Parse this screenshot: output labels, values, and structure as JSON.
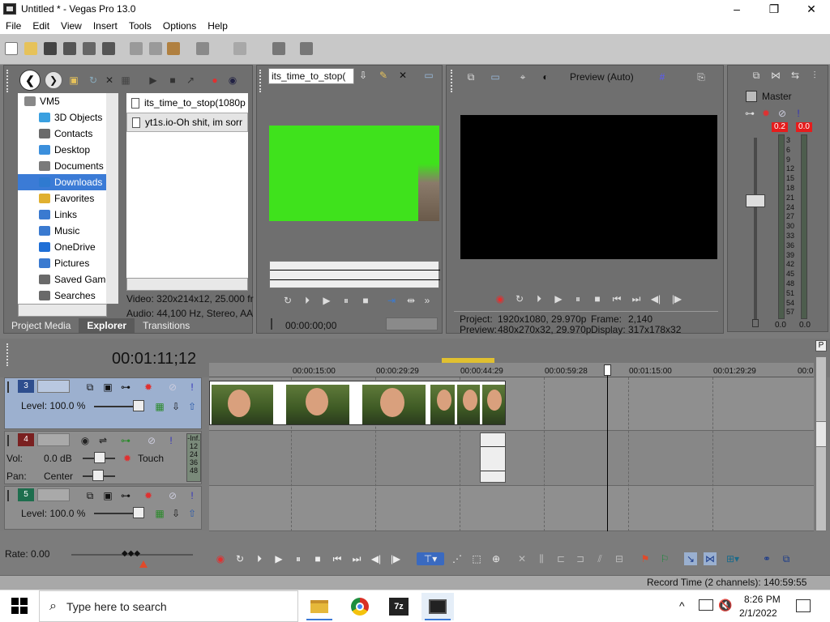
{
  "window": {
    "title": "Untitled * - Vegas Pro 13.0",
    "minimize": "–",
    "maximize": "❐",
    "close": "✕"
  },
  "menu": [
    "File",
    "Edit",
    "View",
    "Insert",
    "Tools",
    "Options",
    "Help"
  ],
  "explorer": {
    "tree": [
      {
        "label": "VM5",
        "icon": "computer-icon",
        "color": "#888888"
      },
      {
        "label": "3D Objects",
        "icon": "3d-objects-icon",
        "color": "#3aa0e0"
      },
      {
        "label": "Contacts",
        "icon": "contacts-icon",
        "color": "#6a6a6a"
      },
      {
        "label": "Desktop",
        "icon": "desktop-icon",
        "color": "#3b8fdc"
      },
      {
        "label": "Documents",
        "icon": "documents-icon",
        "color": "#7a7a7a"
      },
      {
        "label": "Downloads",
        "icon": "downloads-icon",
        "color": "#2f7ad0",
        "selected": true
      },
      {
        "label": "Favorites",
        "icon": "star-icon",
        "color": "#e0b030"
      },
      {
        "label": "Links",
        "icon": "links-icon",
        "color": "#3a7ad0"
      },
      {
        "label": "Music",
        "icon": "music-icon",
        "color": "#3a7ad0"
      },
      {
        "label": "OneDrive",
        "icon": "onedrive-icon",
        "color": "#1f6fd6"
      },
      {
        "label": "Pictures",
        "icon": "pictures-icon",
        "color": "#3a7ad0"
      },
      {
        "label": "Saved Game",
        "icon": "saved-games-icon",
        "color": "#6a6a6a"
      },
      {
        "label": "Searches",
        "icon": "search-icon",
        "color": "#6a6a6a"
      }
    ],
    "files": [
      {
        "label": "its_time_to_stop(1080p"
      },
      {
        "label": "yt1s.io-Oh shit, im sorr",
        "selected": true
      }
    ],
    "info_video": "Video: 320x214x12, 25.000 fr",
    "info_audio": "Audio: 44,100 Hz, Stereo, AA",
    "tabs": [
      "Project Media",
      "Explorer",
      "Transitions"
    ],
    "active_tab": "Explorer"
  },
  "trimmer": {
    "source": "its_time_to_stop(",
    "timecode": "00:00:00;00"
  },
  "preview": {
    "mode": "Preview (Auto)",
    "project_label": "Project:",
    "project_value": "1920x1080, 29.970p",
    "preview_label": "Preview:",
    "preview_value": "480x270x32, 29.970p",
    "frame_label": "Frame:",
    "frame_value": "2,140",
    "display_label": "Display:",
    "display_value": "317x178x32"
  },
  "mixer": {
    "title": "Master",
    "peak_left": "0.2",
    "peak_right": "0.0",
    "scale": [
      "3",
      "6",
      "9",
      "12",
      "15",
      "18",
      "21",
      "24",
      "27",
      "30",
      "33",
      "36",
      "39",
      "42",
      "45",
      "48",
      "51",
      "54",
      "57"
    ],
    "bottom_left": "0.0",
    "bottom_right": "0.0"
  },
  "timeline": {
    "cursor_time": "00:01:11;12",
    "ruler": [
      "00:00:15:00",
      "00:00:29:29",
      "00:00:44:29",
      "00:00:59:28",
      "00:01:15:00",
      "00:01:29:29",
      "00:0"
    ],
    "tracks": [
      {
        "num": "3",
        "type": "video",
        "level": "Level: 100.0 %"
      },
      {
        "num": "4",
        "type": "audio",
        "vol_label": "Vol:",
        "vol_value": "0.0 dB",
        "pan_label": "Pan:",
        "pan_value": "Center",
        "automation": "Touch",
        "meter": [
          "-Inf.",
          "12",
          "24",
          "36",
          "48"
        ]
      },
      {
        "num": "5",
        "type": "video",
        "level": "Level: 100.0 %"
      }
    ]
  },
  "transport": {
    "rate": "Rate: 0.00"
  },
  "status": {
    "record_time": "Record Time (2 channels): 140:59:55"
  },
  "taskbar": {
    "search_placeholder": "Type here to search",
    "time": "8:26 PM",
    "date": "2/1/2022"
  }
}
